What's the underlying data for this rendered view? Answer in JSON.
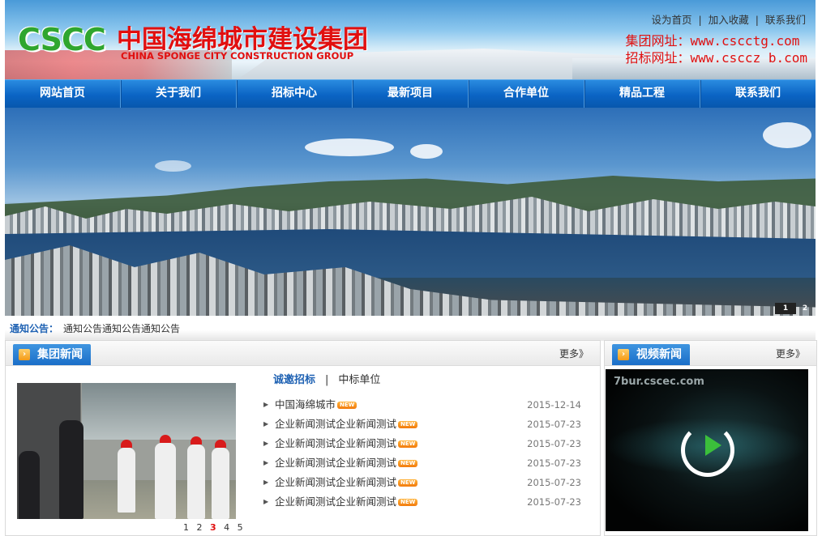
{
  "header": {
    "logo_abbr": "CSCC",
    "logo_cn": "中国海绵城市建设集团",
    "logo_en": "CHINA SPONGE CITY CONSTRUCTION GROUP",
    "top_links": [
      "设为首页",
      "加入收藏",
      "联系我们"
    ],
    "site_line_1": "集团网址：www.cscctg.com",
    "site_line_2": "招标网址：www.csccz b.com"
  },
  "nav": [
    "网站首页",
    "关于我们",
    "招标中心",
    "最新项目",
    "合作单位",
    "精品工程",
    "联系我们"
  ],
  "banner": {
    "pages": [
      "1",
      "2"
    ],
    "active_page": "1"
  },
  "notice": {
    "label": "通知公告：",
    "text": "通知公告通知公告通知公告"
  },
  "news": {
    "title": "集团新闻",
    "more": "更多》",
    "photo_pages": {
      "before": "1 2 ",
      "active": "3",
      "after": " 4 5"
    },
    "subtabs": {
      "active": "诚邀招标",
      "sep": "|",
      "other": "中标单位"
    },
    "new_badge": "NEW",
    "items": [
      {
        "title": "中国海绵城市",
        "date": "2015-12-14"
      },
      {
        "title": "企业新闻测试企业新闻测试",
        "date": "2015-07-23"
      },
      {
        "title": "企业新闻测试企业新闻测试",
        "date": "2015-07-23"
      },
      {
        "title": "企业新闻测试企业新闻测试",
        "date": "2015-07-23"
      },
      {
        "title": "企业新闻测试企业新闻测试",
        "date": "2015-07-23"
      },
      {
        "title": "企业新闻测试企业新闻测试",
        "date": "2015-07-23"
      }
    ]
  },
  "video": {
    "title": "视频新闻",
    "more": "更多》",
    "watermark": "7bur.cscec.com"
  },
  "colors": {
    "nav_blue": "#0b64c4",
    "accent_red": "#e10f0f",
    "logo_green": "#2fa62f",
    "link_blue": "#1f62b3"
  }
}
